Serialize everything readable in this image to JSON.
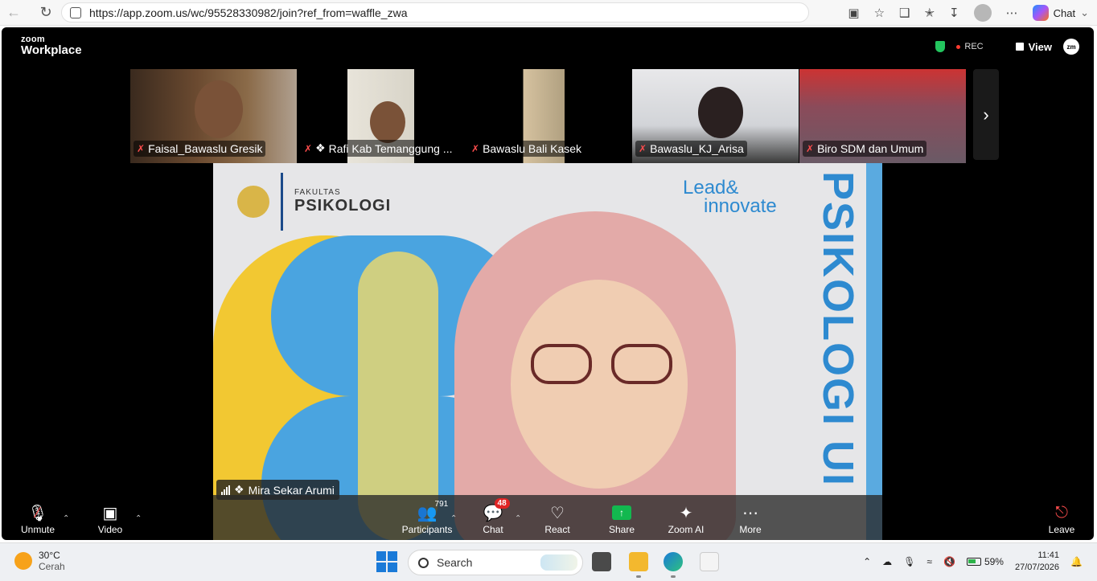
{
  "browser": {
    "url": "https://app.zoom.us/wc/95528330982/join?ref_from=waffle_zwa",
    "chat_label": "Chat"
  },
  "zoom": {
    "brand_small": "zoom",
    "brand_big": "Workplace",
    "rec_label": "REC",
    "view_label": "View",
    "zm_label": "zm"
  },
  "participants": [
    {
      "name": "Faisal_Bawaslu Gresik"
    },
    {
      "name": "Rafi Kab Temanggung ..."
    },
    {
      "name": "Bawaslu Bali Kasek"
    },
    {
      "name": "Bawaslu_KJ_Arisa"
    },
    {
      "name": "Biro SDM dan Umum"
    }
  ],
  "main_video": {
    "speaker": "Mira Sekar Arumi",
    "slide_faculty": "FAKULTAS",
    "slide_dept": "PSIKOLOGI",
    "slide_lead_1": "Lead&",
    "slide_lead_2": "innovate",
    "slide_vertical": "PSIKOLOGI UI"
  },
  "toolbar": {
    "unmute": "Unmute",
    "video": "Video",
    "participants": "Participants",
    "participants_count": "791",
    "chat": "Chat",
    "chat_badge": "48",
    "react": "React",
    "share": "Share",
    "zoom_ai": "Zoom AI",
    "more": "More",
    "leave": "Leave"
  },
  "taskbar": {
    "temp": "30°C",
    "condition": "Cerah",
    "search_placeholder": "Search",
    "battery": "59%",
    "time": "11:41",
    "date": "27/07/2026"
  }
}
